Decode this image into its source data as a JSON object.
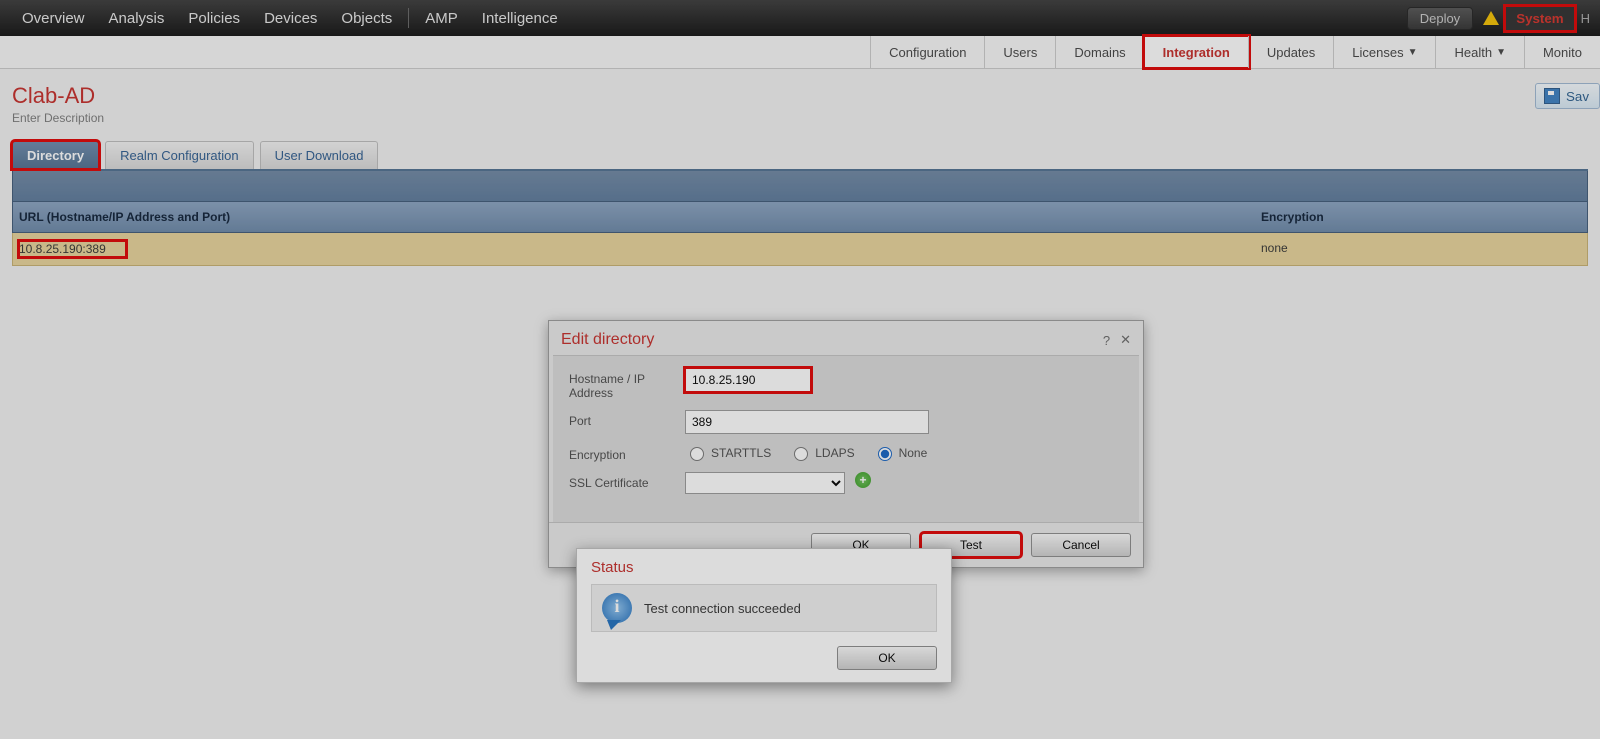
{
  "topnav": {
    "items": [
      "Overview",
      "Analysis",
      "Policies",
      "Devices",
      "Objects",
      "AMP",
      "Intelligence"
    ],
    "deploy": "Deploy",
    "system": "System",
    "tail": "H"
  },
  "subnav": {
    "items": [
      "Configuration",
      "Users",
      "Domains",
      "Integration",
      "Updates",
      "Licenses",
      "Health",
      "Monito"
    ],
    "active_index": 3,
    "dropdown_indices": [
      5,
      6
    ]
  },
  "page": {
    "title": "Clab-AD",
    "subtitle": "Enter Description",
    "save_label": "Sav"
  },
  "tabs": {
    "items": [
      "Directory",
      "Realm Configuration",
      "User Download"
    ],
    "active_index": 0
  },
  "table": {
    "columns": {
      "url": "URL (Hostname/IP Address and Port)",
      "encryption": "Encryption"
    },
    "rows": [
      {
        "url": "10.8.25.190:389",
        "encryption": "none"
      }
    ]
  },
  "dialog": {
    "title": "Edit directory",
    "labels": {
      "hostname": "Hostname / IP Address",
      "port": "Port",
      "encryption": "Encryption",
      "ssl": "SSL Certificate"
    },
    "values": {
      "hostname": "10.8.25.190",
      "port": "389",
      "encryption_selected": "None",
      "ssl_selected": ""
    },
    "encryption_options": [
      "STARTTLS",
      "LDAPS",
      "None"
    ],
    "buttons": {
      "ok": "OK",
      "test": "Test",
      "cancel": "Cancel"
    },
    "icons": {
      "help": "?",
      "close": "✕"
    }
  },
  "status": {
    "title": "Status",
    "message": "Test connection succeeded",
    "ok": "OK"
  }
}
